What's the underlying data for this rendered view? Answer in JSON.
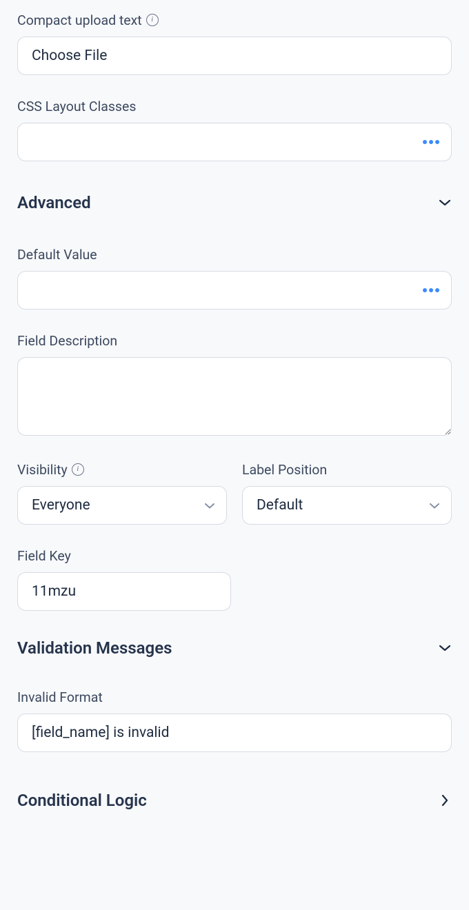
{
  "compact_upload": {
    "label": "Compact upload text",
    "value": "Choose File"
  },
  "css_layout": {
    "label": "CSS Layout Classes",
    "value": ""
  },
  "advanced": {
    "title": "Advanced"
  },
  "default_value": {
    "label": "Default Value",
    "value": ""
  },
  "field_description": {
    "label": "Field Description",
    "value": ""
  },
  "visibility": {
    "label": "Visibility",
    "value": "Everyone"
  },
  "label_position": {
    "label": "Label Position",
    "value": "Default"
  },
  "field_key": {
    "label": "Field Key",
    "value": "11mzu"
  },
  "validation": {
    "title": "Validation Messages"
  },
  "invalid_format": {
    "label": "Invalid Format",
    "value": "[field_name] is invalid"
  },
  "conditional": {
    "title": "Conditional Logic"
  }
}
